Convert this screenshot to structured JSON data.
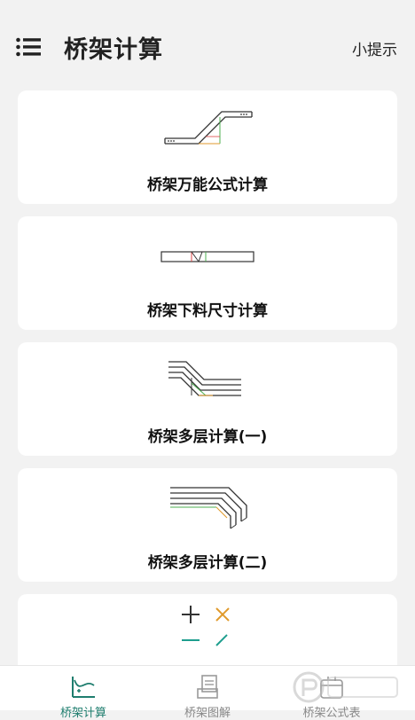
{
  "header": {
    "title": "桥架计算",
    "hint_label": "小提示"
  },
  "cards": [
    {
      "label": "桥架万能公式计算"
    },
    {
      "label": "桥架下料尺寸计算"
    },
    {
      "label": "桥架多层计算(一)"
    },
    {
      "label": "桥架多层计算(二)"
    }
  ],
  "tabs": [
    {
      "label": "桥架计算",
      "active": true
    },
    {
      "label": "桥架图解",
      "active": false
    },
    {
      "label": "桥架公式表",
      "active": false
    }
  ],
  "colors": {
    "accent": "#1e7d6e",
    "diagram_green": "#4caf50",
    "diagram_orange": "#e09a2c",
    "diagram_red": "#d44"
  }
}
